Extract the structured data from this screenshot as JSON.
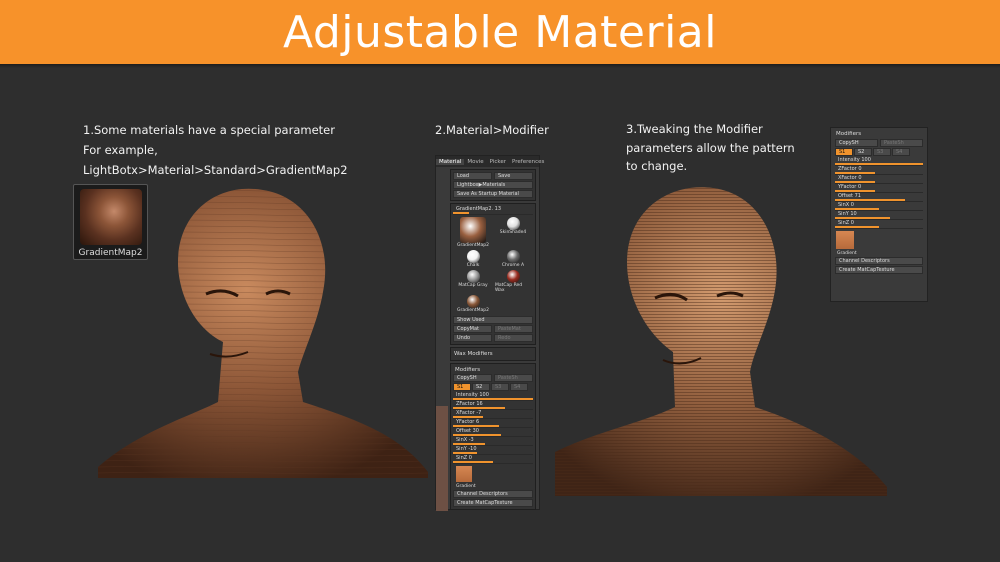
{
  "banner": {
    "title": "Adjustable Material"
  },
  "captions": {
    "step1": [
      "1.Some materials have a special parameter",
      "For example,",
      "LightBotx>Material>Standard>GradientMap2"
    ],
    "step2": "2.Material>Modifier",
    "step3": [
      "3.Tweaking the Modifier",
      "parameters allow the pattern",
      "to change."
    ]
  },
  "thumbnail": {
    "label": "GradientMap2"
  },
  "colors": {
    "banner": "#f7922a",
    "background": "#2e2e2e",
    "slider_fill": "#f0932d",
    "skin": "#a06a45"
  },
  "material_panel": {
    "tabs": [
      "Material",
      "Movie",
      "Picker",
      "Preferences"
    ],
    "load": "Load",
    "save": "Save",
    "lightbox": "Lightbox▶Materials",
    "save_startup": "Save As Startup Material",
    "current_material": "GradientMap2. 13",
    "materials": [
      {
        "name": "GradientMap2",
        "color": "#9a6040"
      },
      {
        "name": "SkinShade4",
        "color": "#e0e0e0"
      },
      {
        "name": "Chalk",
        "color": "#f2f2f2"
      },
      {
        "name": "Chrome A",
        "color": "#6a6a6a"
      },
      {
        "name": "MatCap Gray",
        "color": "#9a9a9a"
      },
      {
        "name": "MatCap Red Wax",
        "color": "#9a2c20"
      },
      {
        "name": "GradientMap2",
        "color": "#8a5838"
      }
    ],
    "show_used": "Show Used",
    "copy_mat": "CopyMat",
    "paste_mat": "PasteMat",
    "undo": "Undo",
    "redo": "Redo",
    "wax_modifiers": "Wax Modifiers",
    "modifiers_title": "Modifiers",
    "copy_sh": "CopySH",
    "paste_sh": "PasteSh",
    "s_buttons": [
      "S1",
      "S2",
      "S3",
      "S4"
    ],
    "sliders": [
      {
        "label": "Intensity 100",
        "fill": 1.0
      },
      {
        "label": "ZFactor 16",
        "fill": 0.65
      },
      {
        "label": "XFactor -7",
        "fill": 0.38
      },
      {
        "label": "YFactor 6",
        "fill": 0.58
      },
      {
        "label": "Offset 30",
        "fill": 0.6
      },
      {
        "label": "SinX -3",
        "fill": 0.4
      },
      {
        "label": "SinY -10",
        "fill": 0.3
      },
      {
        "label": "SinZ 0",
        "fill": 0.5
      }
    ],
    "gradient_label": "Gradient",
    "channel_descriptors": "Channel Descriptors",
    "create_matcap": "Create MatCapTexture"
  },
  "modifier_panel_right": {
    "title": "Modifiers",
    "copy_sh": "CopySH",
    "paste_sh": "PasteSh",
    "s_buttons": [
      "S1",
      "S2",
      "S3",
      "S4"
    ],
    "sliders": [
      {
        "label": "Intensity 100",
        "fill": 1.0
      },
      {
        "label": "ZFactor 0",
        "fill": 0.45
      },
      {
        "label": "XFactor 0",
        "fill": 0.45
      },
      {
        "label": "YFactor 0",
        "fill": 0.45
      },
      {
        "label": "Offset 71",
        "fill": 0.8
      },
      {
        "label": "SinX 0",
        "fill": 0.5
      },
      {
        "label": "SinY 10",
        "fill": 0.62
      },
      {
        "label": "SinZ 0",
        "fill": 0.5
      }
    ],
    "gradient_label": "Gradient",
    "channel_descriptors": "Channel Descriptors",
    "create_matcap": "Create MatCapTexture"
  }
}
